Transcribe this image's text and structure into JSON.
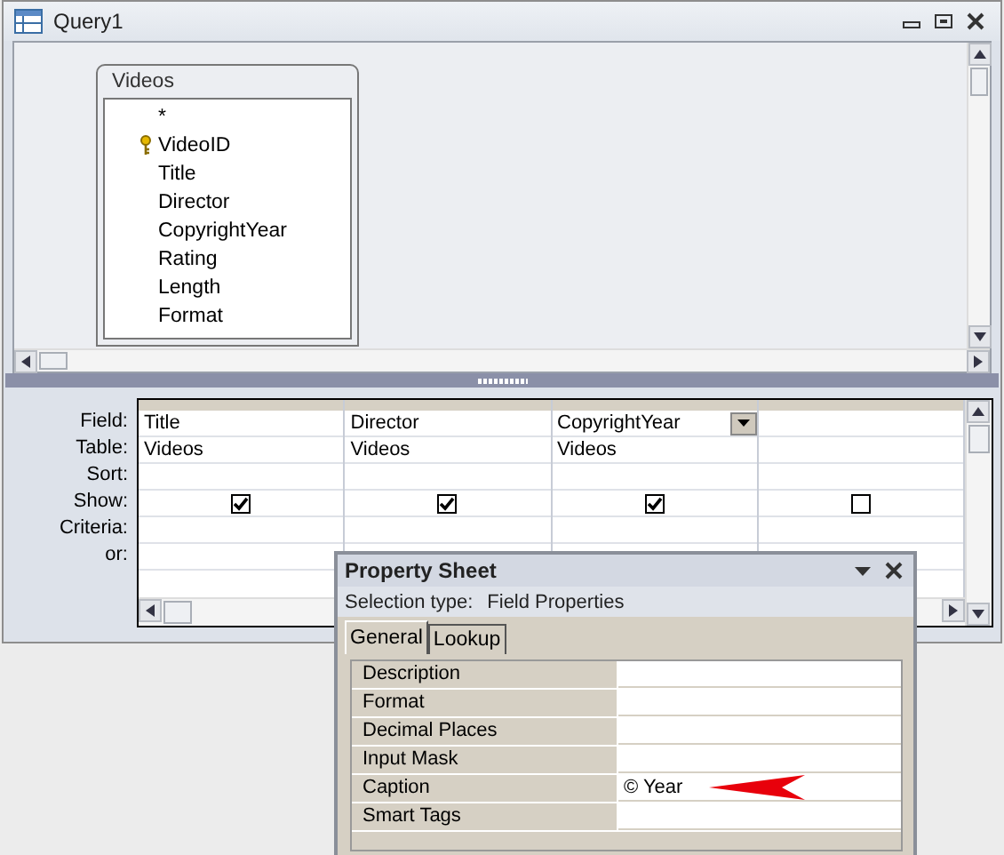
{
  "window": {
    "title": "Query1"
  },
  "table_box": {
    "title": "Videos",
    "fields": [
      {
        "name": "*",
        "primary_key": false
      },
      {
        "name": "VideoID",
        "primary_key": true
      },
      {
        "name": "Title",
        "primary_key": false
      },
      {
        "name": "Director",
        "primary_key": false
      },
      {
        "name": "CopyrightYear",
        "primary_key": false
      },
      {
        "name": "Rating",
        "primary_key": false
      },
      {
        "name": "Length",
        "primary_key": false
      },
      {
        "name": "Format",
        "primary_key": false
      }
    ]
  },
  "grid": {
    "row_labels": [
      "Field:",
      "Table:",
      "Sort:",
      "Show:",
      "Criteria:",
      "or:"
    ],
    "columns": [
      {
        "field": "Title",
        "table": "Videos",
        "show": true,
        "selected": false
      },
      {
        "field": "Director",
        "table": "Videos",
        "show": true,
        "selected": false
      },
      {
        "field": "CopyrightYear",
        "table": "Videos",
        "show": true,
        "selected": true
      },
      {
        "show": false,
        "selected": false
      }
    ]
  },
  "property_sheet": {
    "title": "Property Sheet",
    "selection_type_label": "Selection type:",
    "selection_type": "Field Properties",
    "tabs": [
      {
        "label": "General",
        "selected": true
      },
      {
        "label": "Lookup",
        "selected": false
      }
    ],
    "properties": [
      {
        "name": "Description",
        "pointer": false
      },
      {
        "name": "Format",
        "pointer": false
      },
      {
        "name": "Decimal Places",
        "pointer": false
      },
      {
        "name": "Input Mask",
        "pointer": false
      },
      {
        "name": "Caption",
        "value": "© Year",
        "pointer": true
      },
      {
        "name": "Smart Tags",
        "pointer": false
      }
    ]
  }
}
